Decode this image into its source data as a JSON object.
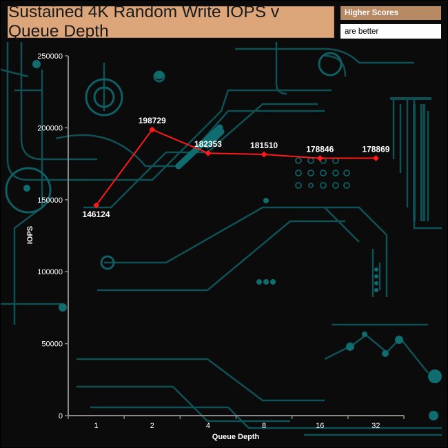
{
  "title": "Sustained 4K Random Write IOPS v Queue Depth",
  "legend_badge": {
    "line1": "Higher Scores",
    "line2": "are better"
  },
  "colors": {
    "series": "#ff1a1a",
    "title_bg": "#dca67a",
    "badge_bg": "#b88a64",
    "circuit": "#0f5f63"
  },
  "chart_data": {
    "type": "line",
    "title": "Sustained 4K Random Write IOPS v Queue Depth",
    "xlabel": "Queue Depth",
    "ylabel": "IOPS",
    "categories": [
      "1",
      "2",
      "4",
      "8",
      "16",
      "32"
    ],
    "ylim": [
      0,
      250000
    ],
    "yticks": [
      0,
      50000,
      100000,
      150000,
      200000,
      250000
    ],
    "grid": false,
    "series": [
      {
        "values": [
          146124,
          198729,
          182353,
          181510,
          178846,
          178869
        ]
      }
    ]
  }
}
